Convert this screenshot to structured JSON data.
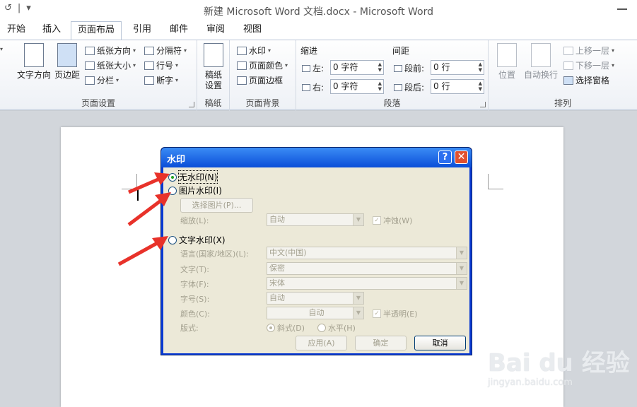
{
  "window": {
    "title": "新建 Microsoft Word 文档.docx - Microsoft Word"
  },
  "qat": {
    "undo_glyph": "↺",
    "sep": "|",
    "more": "▾"
  },
  "tabs": [
    {
      "label": "开始"
    },
    {
      "label": "插入"
    },
    {
      "label": "页面布局"
    },
    {
      "label": "引用"
    },
    {
      "label": "邮件"
    },
    {
      "label": "审阅"
    },
    {
      "label": "视图"
    }
  ],
  "ribbon": {
    "page_setup": {
      "label": "页面设置",
      "text_direction": "文字方向",
      "margins": "页边距",
      "orientation": "纸张方向",
      "size": "纸张大小",
      "columns": "分栏",
      "breaks": "分隔符",
      "line_numbers": "行号",
      "hyphenation": "断字"
    },
    "manuscript": {
      "label": "稿纸",
      "btn_line1": "稿纸",
      "btn_line2": "设置"
    },
    "page_background": {
      "label": "页面背景",
      "watermark": "水印",
      "page_color": "页面颜色",
      "page_borders": "页面边框"
    },
    "paragraph": {
      "label": "段落",
      "indent": "缩进",
      "spacing": "间距",
      "left_label": "左:",
      "right_label": "右:",
      "before_label": "段前:",
      "after_label": "段后:",
      "left_value": "0 字符",
      "right_value": "0 字符",
      "before_value": "0 行",
      "after_value": "0 行"
    },
    "arrange": {
      "label": "排列",
      "position": "位置",
      "wrap_text": "自动换行",
      "bring_forward": "上移一层",
      "send_backward": "下移一层",
      "selection_pane": "选择窗格"
    }
  },
  "dialog": {
    "title": "水印",
    "help": "?",
    "close": "✕",
    "no_watermark": "无水印(N)",
    "picture_watermark": "图片水印(I)",
    "select_picture": "选择图片(P)...",
    "scale_label": "缩放(L):",
    "scale_value": "自动",
    "washout": "冲蚀(W)",
    "text_watermark": "文字水印(X)",
    "language_label": "语言(国家/地区)(L):",
    "language_value": "中文(中国)",
    "text_label": "文字(T):",
    "text_value": "保密",
    "font_label": "字体(F):",
    "font_value": "宋体",
    "size_label": "字号(S):",
    "size_value": "自动",
    "color_label": "颜色(C):",
    "color_value": "自动",
    "semitransparent": "半透明(E)",
    "layout_label": "版式:",
    "diagonal": "斜式(D)",
    "horizontal": "水平(H)",
    "apply": "应用(A)",
    "ok": "确定",
    "cancel": "取消"
  },
  "watermark": {
    "brand": "Bai du 经验",
    "url": "jingyan.baidu.com"
  },
  "colors": {
    "arrow": "#e8322a",
    "dialog_frame": "#0a3ad2",
    "dialog_body": "#ece9d8"
  }
}
